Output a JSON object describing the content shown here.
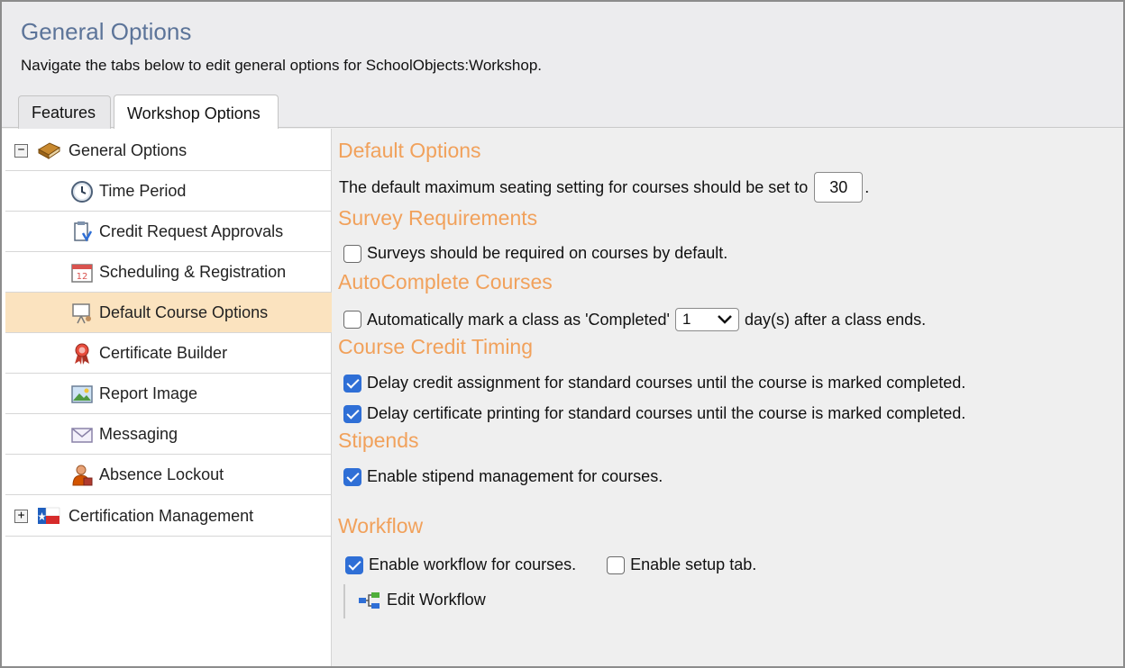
{
  "header": {
    "title": "General Options",
    "subtitle": "Navigate the tabs below to edit general options for SchoolObjects:Workshop."
  },
  "tabs": [
    {
      "label": "Features",
      "active": false
    },
    {
      "label": "Workshop Options",
      "active": true
    }
  ],
  "sidebar": {
    "root": {
      "label": "General Options",
      "expander": "−",
      "icon": "book-icon"
    },
    "items": [
      {
        "label": "Time Period",
        "icon": "clock-icon"
      },
      {
        "label": "Credit Request Approvals",
        "icon": "approval-document-icon"
      },
      {
        "label": "Scheduling & Registration",
        "icon": "calendar-icon"
      },
      {
        "label": "Default Course Options",
        "icon": "presentation-board-icon",
        "selected": true
      },
      {
        "label": "Certificate Builder",
        "icon": "award-ribbon-icon"
      },
      {
        "label": "Report Image",
        "icon": "picture-icon"
      },
      {
        "label": "Messaging",
        "icon": "envelope-icon"
      },
      {
        "label": "Absence Lockout",
        "icon": "user-lock-icon"
      }
    ],
    "root2": {
      "label": "Certification Management",
      "expander": "+",
      "icon": "flag-icon"
    }
  },
  "content": {
    "default_options": {
      "title": "Default Options",
      "text_before": "The default maximum seating setting for courses should be set to",
      "value": "30",
      "text_after": "."
    },
    "survey": {
      "title": "Survey Requirements",
      "checkbox_label": "Surveys should be required on courses by default.",
      "checked": false
    },
    "autocomplete": {
      "title": "AutoComplete Courses",
      "text_before": "Automatically mark a class as 'Completed'",
      "selected_value": "1",
      "text_after": "day(s) after a class ends.",
      "checked": false
    },
    "credit_timing": {
      "title": "Course Credit Timing",
      "items": [
        {
          "label": "Delay credit assignment for standard courses until the course is marked completed.",
          "checked": true
        },
        {
          "label": "Delay certificate printing for standard courses until the course is marked completed.",
          "checked": true
        }
      ]
    },
    "stipends": {
      "title": "Stipends",
      "checkbox_label": "Enable stipend management for courses.",
      "checked": true
    },
    "workflow": {
      "title": "Workflow",
      "enable_label": "Enable workflow for courses.",
      "enable_checked": true,
      "setup_label": "Enable setup tab.",
      "setup_checked": false,
      "edit_label": "Edit Workflow"
    }
  },
  "colors": {
    "title_blue": "#5c7499",
    "section_orange": "#f1a15b",
    "selected_bg": "#fbe3bf",
    "checkbox_blue": "#2f6fd6"
  }
}
